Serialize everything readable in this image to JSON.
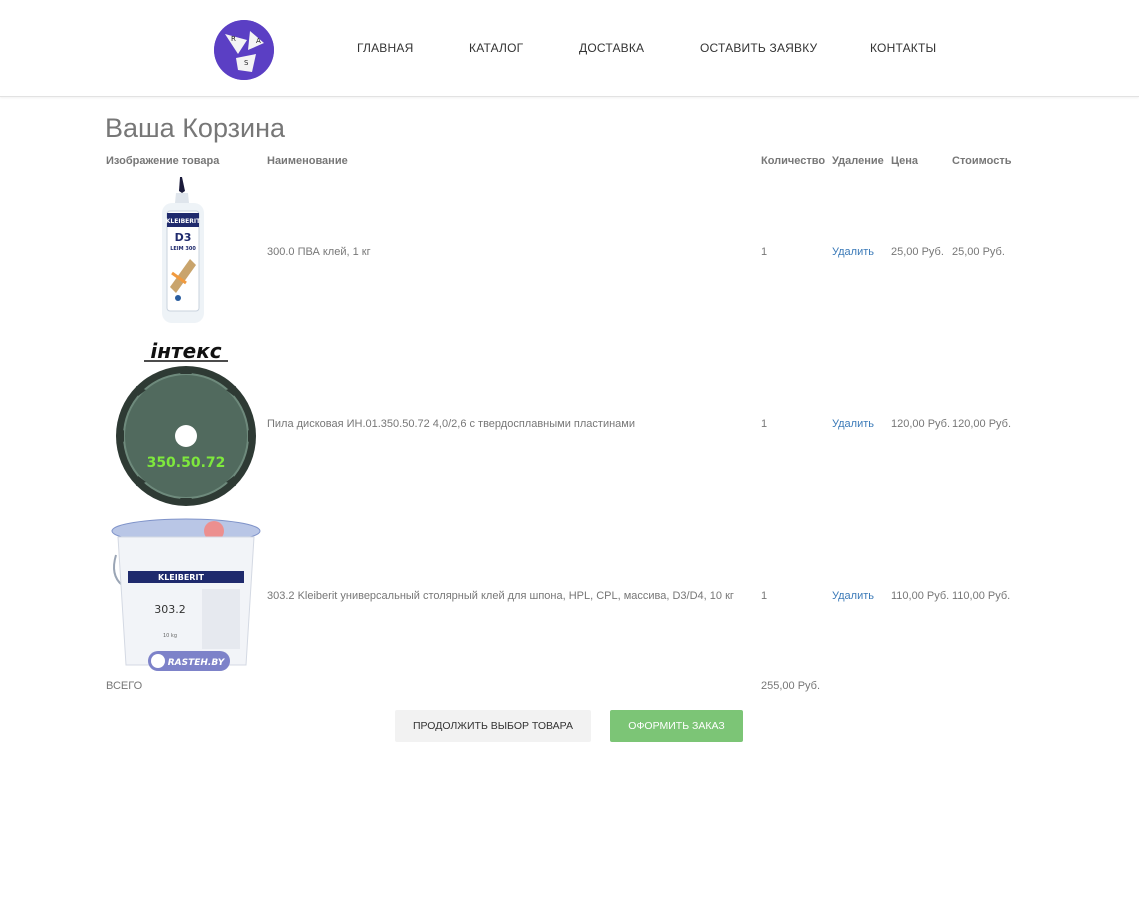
{
  "header": {
    "logo": {
      "icon": "ras-logo",
      "letters": [
        "R",
        "A",
        "S"
      ]
    },
    "nav": [
      {
        "label": "ГЛАВНАЯ"
      },
      {
        "label": "КАТАЛОГ"
      },
      {
        "label": "ДОСТАВКА"
      },
      {
        "label": "ОСТАВИТЬ ЗАЯВКУ"
      },
      {
        "label": "КОНТАКТЫ"
      }
    ]
  },
  "page_title": "Ваша Корзина",
  "table": {
    "headers": {
      "image": "Изображение товара",
      "name": "Наименование",
      "qty": "Количество",
      "remove": "Удаление",
      "price": "Цена",
      "total": "Стоимость"
    },
    "rows": [
      {
        "image": {
          "icon": "glue-bottle-image",
          "brand": "KLEIBERIT",
          "code": "D3",
          "sub": "LEIM 300"
        },
        "name": "300.0 ПВА клей, 1 кг",
        "qty": "1",
        "remove": "Удалить",
        "price": "25,00 Руб.",
        "total": "25,00 Руб."
      },
      {
        "image": {
          "icon": "saw-blade-image",
          "brand": "інтекс",
          "code": "350.50.72"
        },
        "name": "Пила дисковая ИН.01.350.50.72 4,0/2,6 с твердосплавными пластинами",
        "qty": "1",
        "remove": "Удалить",
        "price": "120,00 Руб.",
        "total": "120,00 Руб."
      },
      {
        "image": {
          "icon": "glue-bucket-image",
          "brand": "KLEIBERIT",
          "code": "303.2",
          "weight": "10 kg",
          "badge": "RASTEH.BY"
        },
        "name": "303.2 Kleiberit универсальный столярный клей для шпона, HPL, CPL, массива, D3/D4, 10 кг",
        "qty": "1",
        "remove": "Удалить",
        "price": "110,00 Руб.",
        "total": "110,00 Руб."
      }
    ],
    "summary": {
      "label": "ВСЕГО",
      "value": "255,00 Руб."
    }
  },
  "buttons": {
    "continue": "Продолжить выбор товара",
    "order": "Оформить заказ"
  },
  "colors": {
    "link": "#3b7ab8",
    "order_button": "#7cc576",
    "continue_button": "#f2f2f2",
    "logo": "#5b3fc4"
  }
}
